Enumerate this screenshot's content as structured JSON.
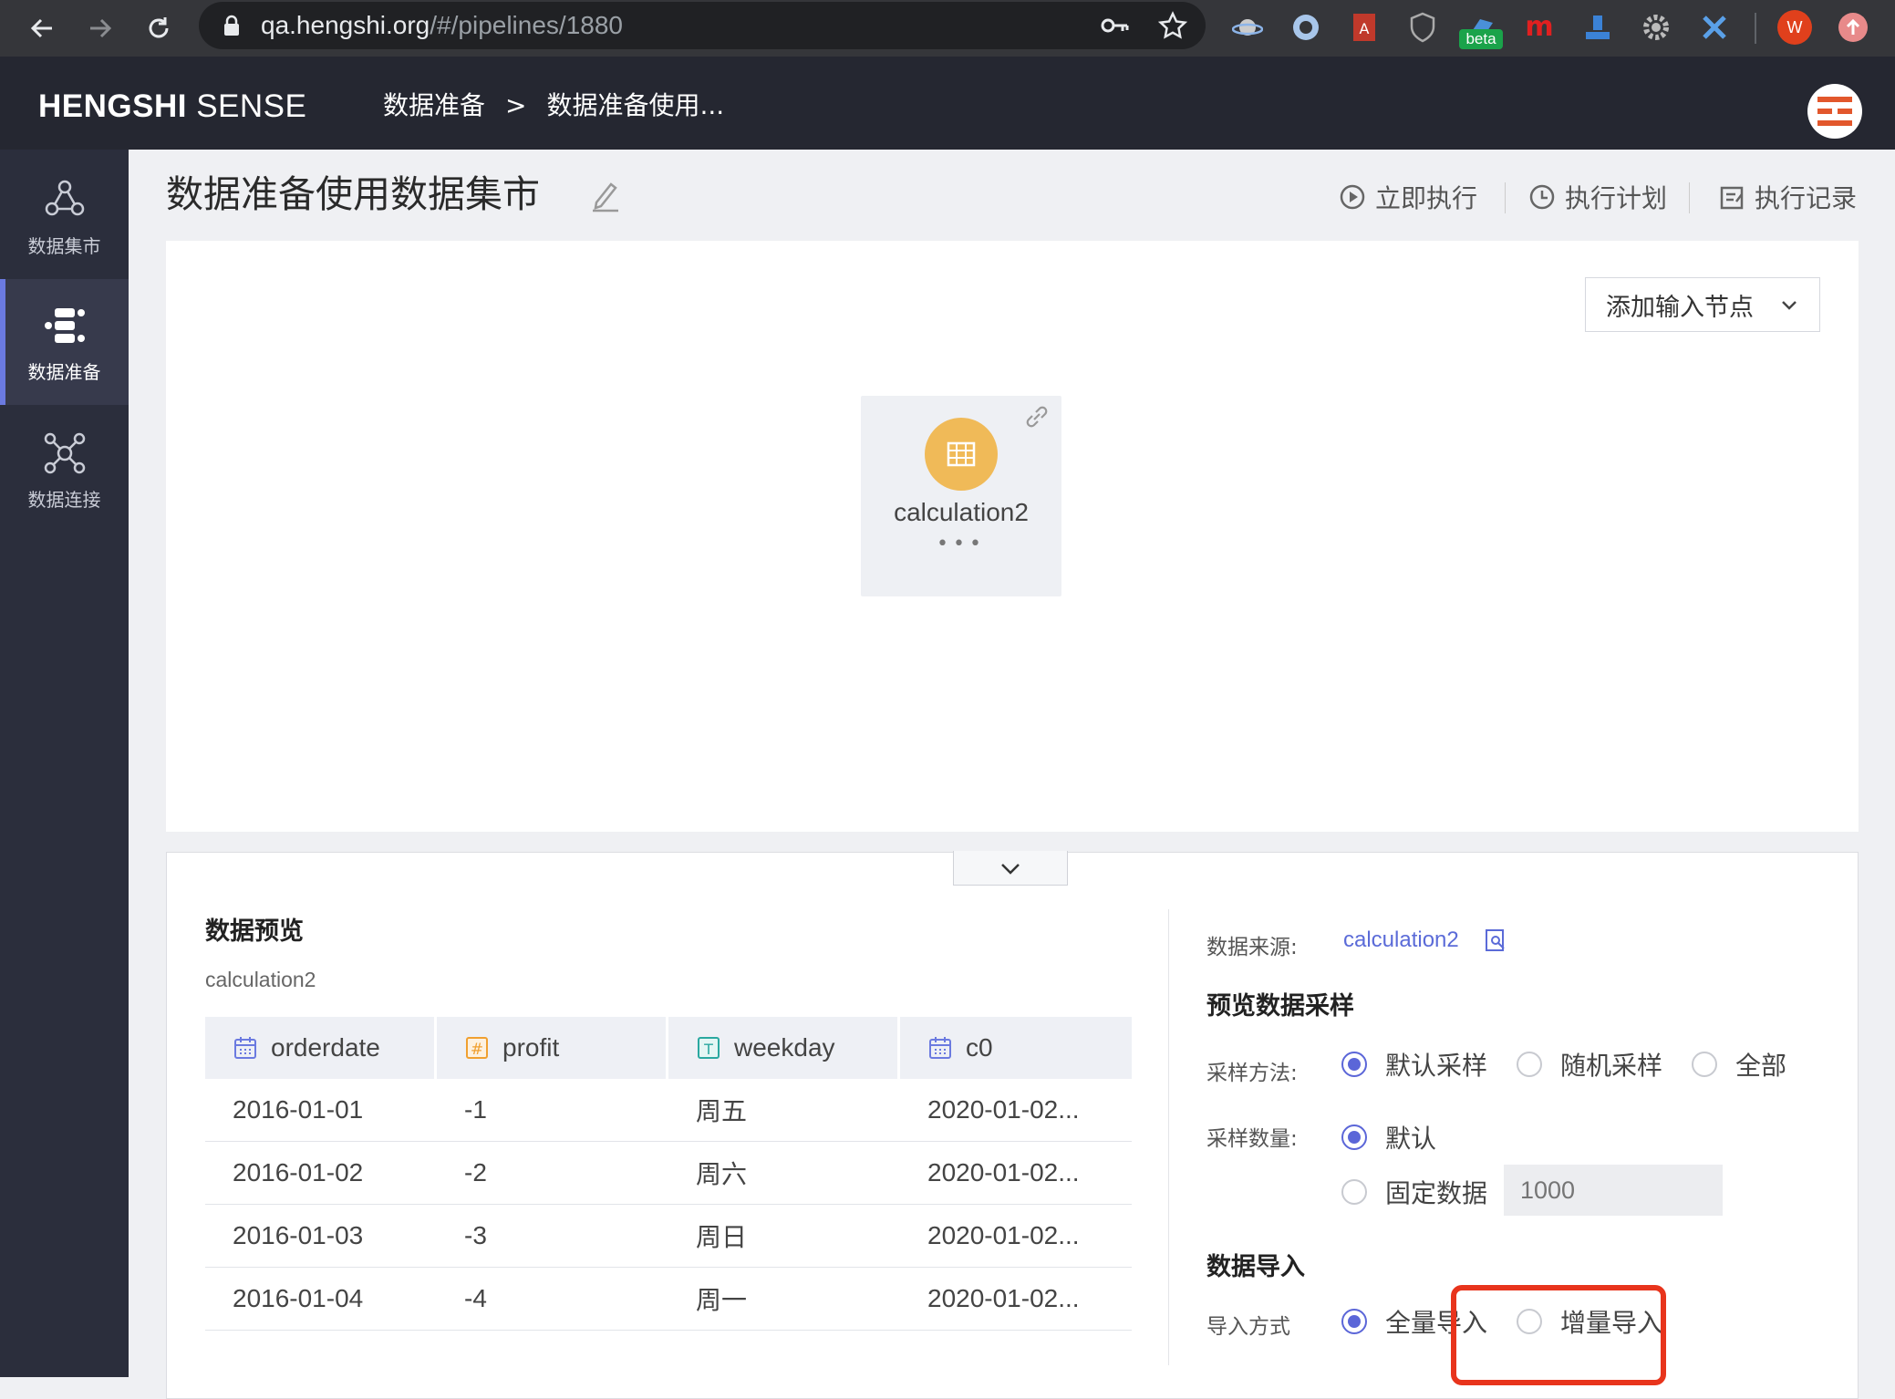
{
  "browser": {
    "url_host": "qa.hengshi.org",
    "url_path": "/#/pipelines/1880",
    "beta_badge": "beta",
    "profile_initial": "W"
  },
  "app": {
    "logo_bold": "HENGSHI",
    "logo_light": " SENSE",
    "breadcrumb": [
      "数据准备",
      ">",
      "数据准备使用..."
    ]
  },
  "sidebar": {
    "items": [
      {
        "label": "数据集市",
        "icon": "datamart-icon"
      },
      {
        "label": "数据准备",
        "icon": "pipeline-icon",
        "active": true
      },
      {
        "label": "数据连接",
        "icon": "connection-icon"
      }
    ]
  },
  "page": {
    "title": "数据准备使用数据集市",
    "actions": {
      "run_now": "立即执行",
      "schedule": "执行计划",
      "history": "执行记录"
    }
  },
  "canvas": {
    "add_node_label": "添加输入节点",
    "node": {
      "name": "calculation2",
      "more": "•••"
    }
  },
  "preview": {
    "title": "数据预览",
    "subtitle": "calculation2",
    "columns": [
      {
        "name": "orderdate",
        "type": "date"
      },
      {
        "name": "profit",
        "type": "number"
      },
      {
        "name": "weekday",
        "type": "text"
      },
      {
        "name": "c0",
        "type": "date"
      }
    ],
    "rows": [
      [
        "2016-01-01",
        "-1",
        "周五",
        "2020-01-02..."
      ],
      [
        "2016-01-02",
        "-2",
        "周六",
        "2020-01-02..."
      ],
      [
        "2016-01-03",
        "-3",
        "周日",
        "2020-01-02..."
      ],
      [
        "2016-01-04",
        "-4",
        "周一",
        "2020-01-02..."
      ]
    ]
  },
  "config": {
    "source_label": "数据来源:",
    "source_value": "calculation2",
    "sampling_title": "预览数据采样",
    "method_label": "采样方法:",
    "method_options": [
      "默认采样",
      "随机采样",
      "全部"
    ],
    "count_label": "采样数量:",
    "count_options": [
      "默认",
      "固定数据"
    ],
    "count_placeholder": "1000",
    "import_title": "数据导入",
    "import_label": "导入方式",
    "import_options": [
      "全量导入",
      "增量导入"
    ]
  },
  "colors": {
    "accent": "#5b66d8",
    "node": "#f0ba58",
    "highlight": "#e8341c",
    "sidebar": "#2b2e3c",
    "header": "#252731"
  }
}
